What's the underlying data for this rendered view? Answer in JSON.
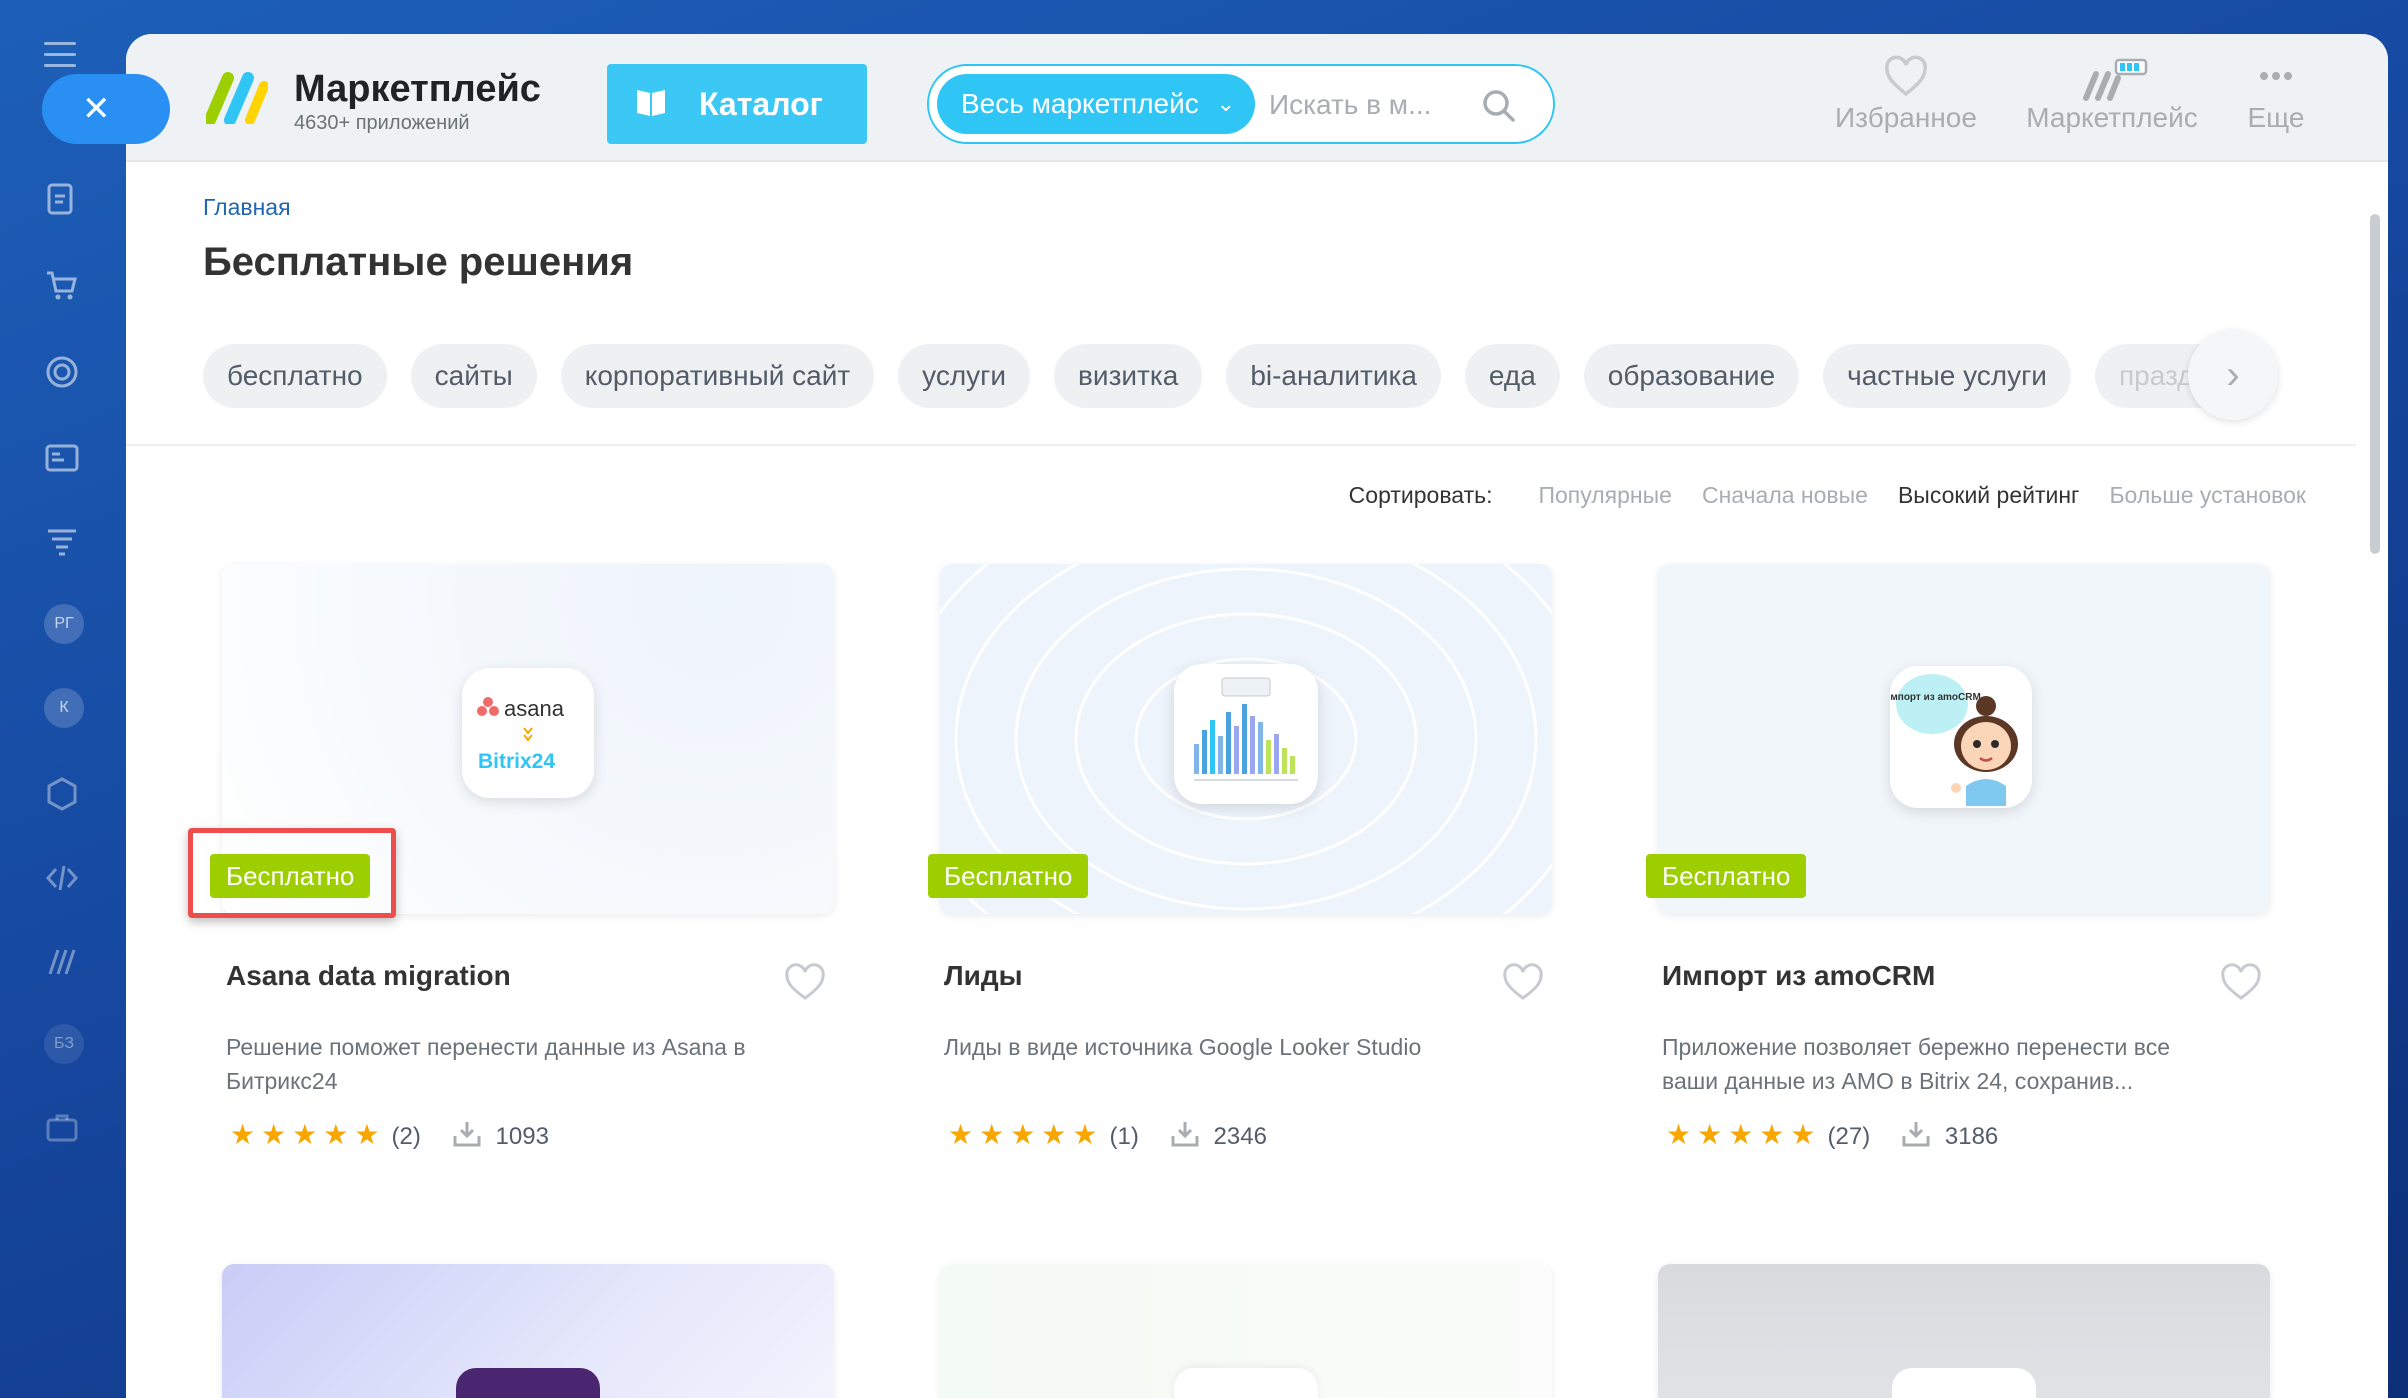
{
  "header": {
    "logo_title": "Маркетплейс",
    "logo_subtitle": "4630+ приложений",
    "catalog_label": "Каталог",
    "search_scope": "Весь маркетплейс",
    "search_placeholder": "Искать в м...",
    "actions": [
      {
        "label": "Избранное",
        "icon": "heart-icon"
      },
      {
        "label": "Маркетплейс",
        "icon": "marketplace-icon"
      },
      {
        "label": "Еще",
        "icon": "more-icon"
      }
    ]
  },
  "breadcrumb": "Главная",
  "page_title": "Бесплатные решения",
  "tags": [
    "бесплатно",
    "сайты",
    "корпоративный сайт",
    "услуги",
    "визитка",
    "bi-аналитика",
    "еда",
    "образование",
    "частные услуги",
    "праздники"
  ],
  "sort": {
    "label": "Сортировать:",
    "options": [
      "Популярные",
      "Сначала новые",
      "Высокий рейтинг",
      "Больше установок"
    ],
    "active": "Высокий рейтинг"
  },
  "cards": [
    {
      "badge": "Бесплатно",
      "name": "Asana data migration",
      "description": "Решение поможет перенести данные из Asana в Битрикс24",
      "rating": 5,
      "reviews": "(2)",
      "installs": "1093",
      "icon_text_top": "asana",
      "icon_text_bottom": "Bitrix24"
    },
    {
      "badge": "Бесплатно",
      "name": "Лиды",
      "description": "Лиды в виде источника Google Looker Studio",
      "rating": 5,
      "reviews": "(1)",
      "installs": "2346"
    },
    {
      "badge": "Бесплатно",
      "name": "Импорт из amoCRM",
      "description": "Приложение позволяет бережно перенести все ваши данные из AMO в Bitrix 24, сохранив...",
      "rating": 5,
      "reviews": "(27)",
      "installs": "3186",
      "icon_text": "Импорт из amoCRM"
    }
  ],
  "stars_text": "★★★★★",
  "colors": {
    "accent": "#3bc8f5",
    "badge": "#9dcf00",
    "highlight": "#ee4d4d",
    "star": "#f7a700"
  }
}
